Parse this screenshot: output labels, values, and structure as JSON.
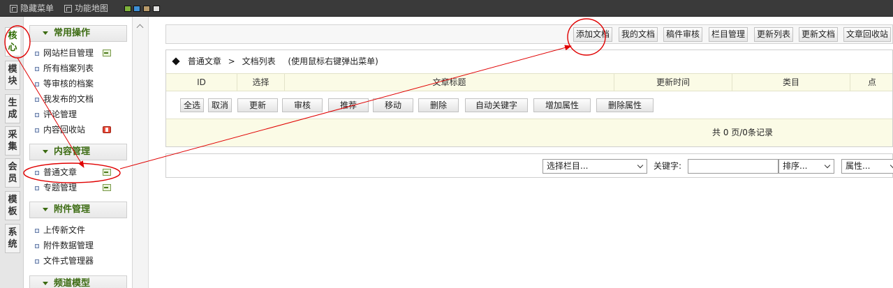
{
  "topbar": {
    "hide_menu": "隐藏菜单",
    "site_map": "功能地图",
    "swatches": [
      "#7fb33b",
      "#3d8fd6",
      "#b89a6a",
      "#e0e0e0"
    ]
  },
  "vtabs": [
    {
      "label": "核心",
      "active": true
    },
    {
      "label": "模块"
    },
    {
      "label": "生成"
    },
    {
      "label": "采集"
    },
    {
      "label": "会员"
    },
    {
      "label": "模板"
    },
    {
      "label": "系统"
    }
  ],
  "menu": {
    "group1": {
      "title": "常用操作",
      "items": [
        "网站栏目管理",
        "所有档案列表",
        "等审核的档案",
        "我发布的文档",
        "评论管理",
        "内容回收站"
      ]
    },
    "group2": {
      "title": "内容管理",
      "items": [
        "普通文章",
        "专题管理"
      ]
    },
    "group3": {
      "title": "附件管理",
      "items": [
        "上传新文件",
        "附件数据管理",
        "文件式管理器"
      ]
    },
    "group4": {
      "title": "频道模型"
    }
  },
  "toolbar": {
    "buttons": [
      "添加文档",
      "我的文档",
      "稿件审核",
      "栏目管理",
      "更新列表",
      "更新文档",
      "文章回收站"
    ]
  },
  "breadcrumb": {
    "part1": "普通文章",
    "sep": ">",
    "part2": "文档列表",
    "hint": "(使用鼠标右键弹出菜单)"
  },
  "table": {
    "columns": [
      "ID",
      "选择",
      "文章标题",
      "更新时间",
      "类目",
      "点"
    ]
  },
  "actions": [
    "全选",
    "取消",
    "更新",
    "审核",
    "推荐",
    "移动",
    "删除",
    "自动关键字",
    "增加属性",
    "删除属性"
  ],
  "summary": "共 0 页/0条记录",
  "filter": {
    "category": "选择栏目...",
    "keyword_label": "关键字:",
    "sort": "排序...",
    "attr": "属性..."
  },
  "colors": {
    "annotation": "#e00000",
    "menu_green": "#3c6b12"
  }
}
